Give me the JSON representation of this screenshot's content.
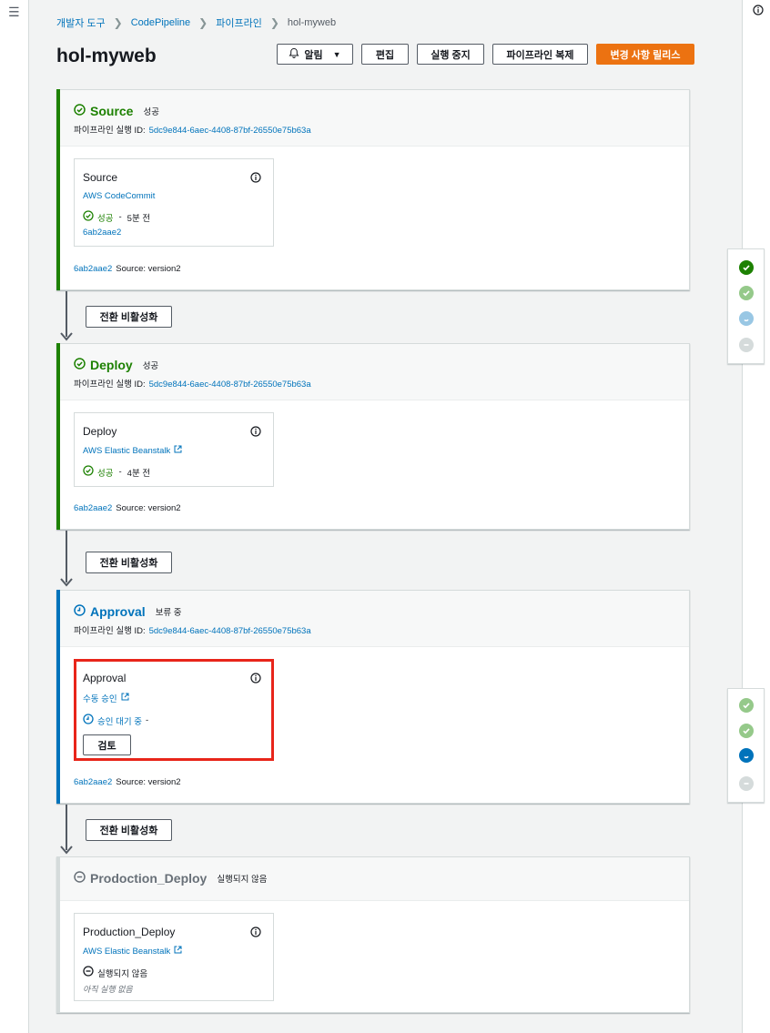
{
  "breadcrumb": [
    "개발자 도구",
    "CodePipeline",
    "파이프라인",
    "hol-myweb"
  ],
  "page_title": "hol-myweb",
  "actions": {
    "alarm": "알림",
    "edit": "편집",
    "stop": "실행 중지",
    "clone": "파이프라인 복제",
    "release": "변경 사항 릴리스"
  },
  "exec_label": "파이프라인 실행 ID:",
  "exec_id": "5dc9e844-6aec-4408-87bf-26550e75b63a",
  "revision": {
    "commit": "6ab2aae2",
    "message": "Source: version2"
  },
  "transition_label": "전환 비활성화",
  "stages": [
    {
      "name": "Source",
      "status": "성공",
      "action": {
        "name": "Source",
        "provider": "AWS CodeCommit",
        "status": "성공",
        "time": "5분 전",
        "link": "6ab2aae2"
      }
    },
    {
      "name": "Deploy",
      "status": "성공",
      "action": {
        "name": "Deploy",
        "provider": "AWS Elastic Beanstalk",
        "status": "성공",
        "time": "4분 전"
      }
    },
    {
      "name": "Approval",
      "status": "보류 중",
      "action": {
        "name": "Approval",
        "provider": "수동 승인",
        "status": "승인 대기 중",
        "time": "-",
        "button": "검토"
      }
    },
    {
      "name": "Prodoction_Deploy",
      "status": "실행되지 않음",
      "action": {
        "name": "Production_Deploy",
        "provider": "AWS Elastic Beanstalk",
        "status": "실행되지 않음",
        "note": "아직 실행 없음"
      }
    }
  ],
  "colors": {
    "success": "#1d8102",
    "in_progress": "#0073bb",
    "inactive": "#687078",
    "accent": "#ec7211",
    "highlight": "#e8251a"
  }
}
